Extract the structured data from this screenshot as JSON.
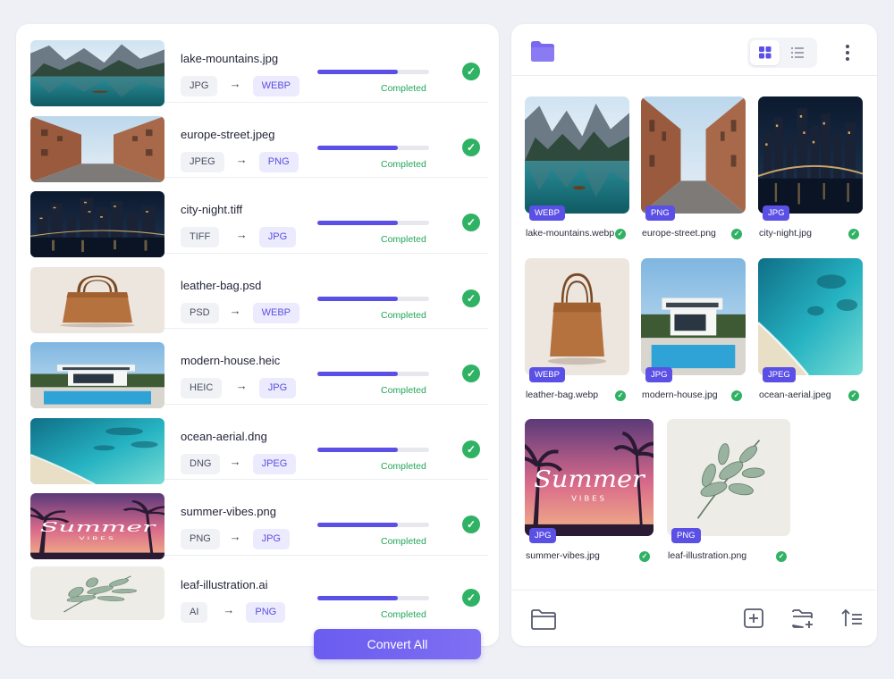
{
  "conversions": [
    {
      "name": "lake-mountains.jpg",
      "from": "JPG",
      "to": "WEBP",
      "progress": 0.72,
      "status": "Completed"
    },
    {
      "name": "europe-street.jpeg",
      "from": "JPEG",
      "to": "PNG",
      "progress": 0.72,
      "status": "Completed"
    },
    {
      "name": "city-night.tiff",
      "from": "TIFF",
      "to": "JPG",
      "progress": 0.72,
      "status": "Completed"
    },
    {
      "name": "leather-bag.psd",
      "from": "PSD",
      "to": "WEBP",
      "progress": 0.72,
      "status": "Completed"
    },
    {
      "name": "modern-house.heic",
      "from": "HEIC",
      "to": "JPG",
      "progress": 0.72,
      "status": "Completed"
    },
    {
      "name": "ocean-aerial.dng",
      "from": "DNG",
      "to": "JPEG",
      "progress": 0.72,
      "status": "Completed"
    },
    {
      "name": "summer-vibes.png",
      "from": "PNG",
      "to": "JPG",
      "progress": 0.72,
      "status": "Completed"
    },
    {
      "name": "leaf-illustration.ai",
      "from": "AI",
      "to": "PNG",
      "progress": 0.72,
      "status": "Completed"
    }
  ],
  "convert_button": "Convert All",
  "arrow_glyph": "→",
  "check_glyph": "✓",
  "output_grid": [
    {
      "name": "lake-mountains.webp",
      "badge": "WEBP",
      "image": "lake"
    },
    {
      "name": "europe-street.png",
      "badge": "PNG",
      "image": "street"
    },
    {
      "name": "city-night.jpg",
      "badge": "JPG",
      "image": "city"
    },
    {
      "name": "leather-bag.webp",
      "badge": "WEBP",
      "image": "bag"
    },
    {
      "name": "modern-house.jpg",
      "badge": "JPG",
      "image": "house"
    },
    {
      "name": "ocean-aerial.jpeg",
      "badge": "JPEG",
      "image": "ocean"
    },
    {
      "name": "summer-vibes.jpg",
      "badge": "JPG",
      "image": "summer"
    },
    {
      "name": "leaf-illustration.png",
      "badge": "PNG",
      "image": "leaf"
    }
  ],
  "summer_art_text": {
    "title": "Summer",
    "subtitle": "VIBES"
  },
  "toolbar_icons": {
    "top": [
      "folder-icon",
      "grid-view-icon",
      "list-view-icon",
      "more-vertical-icon"
    ],
    "bottom": [
      "open-folder-icon",
      "add-file-icon",
      "add-folder-icon",
      "sort-icon"
    ]
  },
  "colors": {
    "accent": "#5b50e6",
    "success": "#2fb264",
    "badge_bg": "#ecebfd"
  }
}
